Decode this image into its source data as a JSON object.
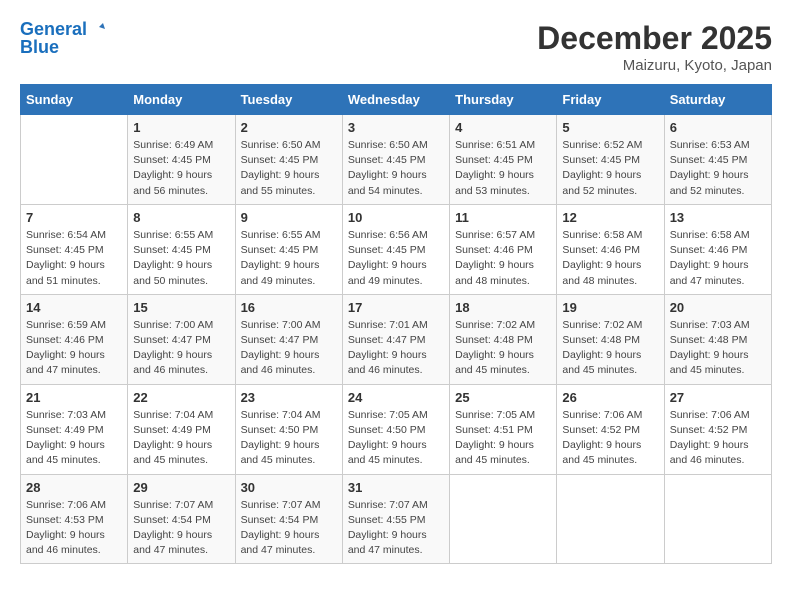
{
  "header": {
    "logo_line1": "General",
    "logo_line2": "Blue",
    "month_title": "December 2025",
    "location": "Maizuru, Kyoto, Japan"
  },
  "days_of_week": [
    "Sunday",
    "Monday",
    "Tuesday",
    "Wednesday",
    "Thursday",
    "Friday",
    "Saturday"
  ],
  "weeks": [
    [
      {
        "num": "",
        "sunrise": "",
        "sunset": "",
        "daylight": ""
      },
      {
        "num": "1",
        "sunrise": "Sunrise: 6:49 AM",
        "sunset": "Sunset: 4:45 PM",
        "daylight": "Daylight: 9 hours and 56 minutes."
      },
      {
        "num": "2",
        "sunrise": "Sunrise: 6:50 AM",
        "sunset": "Sunset: 4:45 PM",
        "daylight": "Daylight: 9 hours and 55 minutes."
      },
      {
        "num": "3",
        "sunrise": "Sunrise: 6:50 AM",
        "sunset": "Sunset: 4:45 PM",
        "daylight": "Daylight: 9 hours and 54 minutes."
      },
      {
        "num": "4",
        "sunrise": "Sunrise: 6:51 AM",
        "sunset": "Sunset: 4:45 PM",
        "daylight": "Daylight: 9 hours and 53 minutes."
      },
      {
        "num": "5",
        "sunrise": "Sunrise: 6:52 AM",
        "sunset": "Sunset: 4:45 PM",
        "daylight": "Daylight: 9 hours and 52 minutes."
      },
      {
        "num": "6",
        "sunrise": "Sunrise: 6:53 AM",
        "sunset": "Sunset: 4:45 PM",
        "daylight": "Daylight: 9 hours and 52 minutes."
      }
    ],
    [
      {
        "num": "7",
        "sunrise": "Sunrise: 6:54 AM",
        "sunset": "Sunset: 4:45 PM",
        "daylight": "Daylight: 9 hours and 51 minutes."
      },
      {
        "num": "8",
        "sunrise": "Sunrise: 6:55 AM",
        "sunset": "Sunset: 4:45 PM",
        "daylight": "Daylight: 9 hours and 50 minutes."
      },
      {
        "num": "9",
        "sunrise": "Sunrise: 6:55 AM",
        "sunset": "Sunset: 4:45 PM",
        "daylight": "Daylight: 9 hours and 49 minutes."
      },
      {
        "num": "10",
        "sunrise": "Sunrise: 6:56 AM",
        "sunset": "Sunset: 4:45 PM",
        "daylight": "Daylight: 9 hours and 49 minutes."
      },
      {
        "num": "11",
        "sunrise": "Sunrise: 6:57 AM",
        "sunset": "Sunset: 4:46 PM",
        "daylight": "Daylight: 9 hours and 48 minutes."
      },
      {
        "num": "12",
        "sunrise": "Sunrise: 6:58 AM",
        "sunset": "Sunset: 4:46 PM",
        "daylight": "Daylight: 9 hours and 48 minutes."
      },
      {
        "num": "13",
        "sunrise": "Sunrise: 6:58 AM",
        "sunset": "Sunset: 4:46 PM",
        "daylight": "Daylight: 9 hours and 47 minutes."
      }
    ],
    [
      {
        "num": "14",
        "sunrise": "Sunrise: 6:59 AM",
        "sunset": "Sunset: 4:46 PM",
        "daylight": "Daylight: 9 hours and 47 minutes."
      },
      {
        "num": "15",
        "sunrise": "Sunrise: 7:00 AM",
        "sunset": "Sunset: 4:47 PM",
        "daylight": "Daylight: 9 hours and 46 minutes."
      },
      {
        "num": "16",
        "sunrise": "Sunrise: 7:00 AM",
        "sunset": "Sunset: 4:47 PM",
        "daylight": "Daylight: 9 hours and 46 minutes."
      },
      {
        "num": "17",
        "sunrise": "Sunrise: 7:01 AM",
        "sunset": "Sunset: 4:47 PM",
        "daylight": "Daylight: 9 hours and 46 minutes."
      },
      {
        "num": "18",
        "sunrise": "Sunrise: 7:02 AM",
        "sunset": "Sunset: 4:48 PM",
        "daylight": "Daylight: 9 hours and 45 minutes."
      },
      {
        "num": "19",
        "sunrise": "Sunrise: 7:02 AM",
        "sunset": "Sunset: 4:48 PM",
        "daylight": "Daylight: 9 hours and 45 minutes."
      },
      {
        "num": "20",
        "sunrise": "Sunrise: 7:03 AM",
        "sunset": "Sunset: 4:48 PM",
        "daylight": "Daylight: 9 hours and 45 minutes."
      }
    ],
    [
      {
        "num": "21",
        "sunrise": "Sunrise: 7:03 AM",
        "sunset": "Sunset: 4:49 PM",
        "daylight": "Daylight: 9 hours and 45 minutes."
      },
      {
        "num": "22",
        "sunrise": "Sunrise: 7:04 AM",
        "sunset": "Sunset: 4:49 PM",
        "daylight": "Daylight: 9 hours and 45 minutes."
      },
      {
        "num": "23",
        "sunrise": "Sunrise: 7:04 AM",
        "sunset": "Sunset: 4:50 PM",
        "daylight": "Daylight: 9 hours and 45 minutes."
      },
      {
        "num": "24",
        "sunrise": "Sunrise: 7:05 AM",
        "sunset": "Sunset: 4:50 PM",
        "daylight": "Daylight: 9 hours and 45 minutes."
      },
      {
        "num": "25",
        "sunrise": "Sunrise: 7:05 AM",
        "sunset": "Sunset: 4:51 PM",
        "daylight": "Daylight: 9 hours and 45 minutes."
      },
      {
        "num": "26",
        "sunrise": "Sunrise: 7:06 AM",
        "sunset": "Sunset: 4:52 PM",
        "daylight": "Daylight: 9 hours and 45 minutes."
      },
      {
        "num": "27",
        "sunrise": "Sunrise: 7:06 AM",
        "sunset": "Sunset: 4:52 PM",
        "daylight": "Daylight: 9 hours and 46 minutes."
      }
    ],
    [
      {
        "num": "28",
        "sunrise": "Sunrise: 7:06 AM",
        "sunset": "Sunset: 4:53 PM",
        "daylight": "Daylight: 9 hours and 46 minutes."
      },
      {
        "num": "29",
        "sunrise": "Sunrise: 7:07 AM",
        "sunset": "Sunset: 4:54 PM",
        "daylight": "Daylight: 9 hours and 47 minutes."
      },
      {
        "num": "30",
        "sunrise": "Sunrise: 7:07 AM",
        "sunset": "Sunset: 4:54 PM",
        "daylight": "Daylight: 9 hours and 47 minutes."
      },
      {
        "num": "31",
        "sunrise": "Sunrise: 7:07 AM",
        "sunset": "Sunset: 4:55 PM",
        "daylight": "Daylight: 9 hours and 47 minutes."
      },
      {
        "num": "",
        "sunrise": "",
        "sunset": "",
        "daylight": ""
      },
      {
        "num": "",
        "sunrise": "",
        "sunset": "",
        "daylight": ""
      },
      {
        "num": "",
        "sunrise": "",
        "sunset": "",
        "daylight": ""
      }
    ]
  ]
}
